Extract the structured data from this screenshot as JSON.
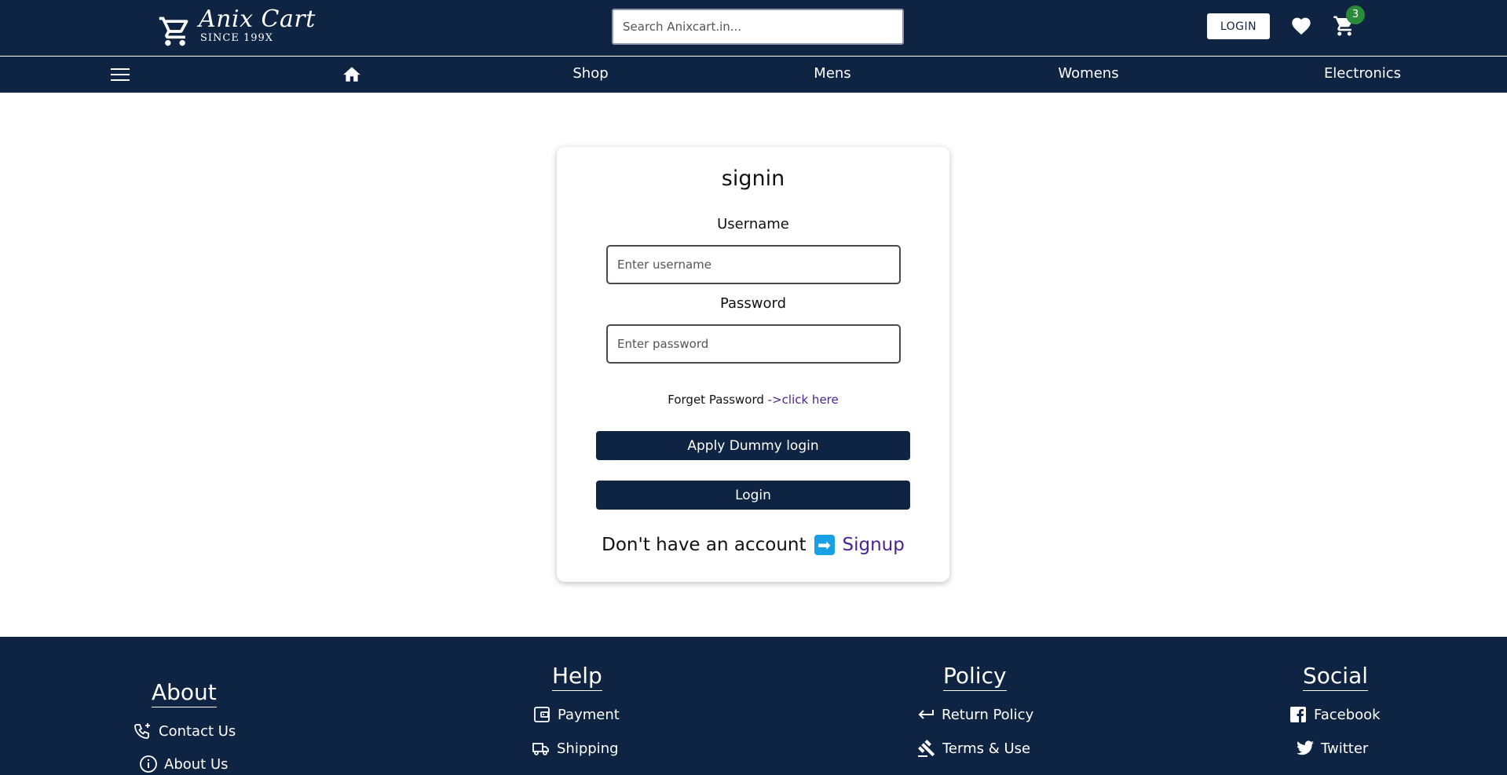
{
  "header": {
    "brand_name": "Anix Cart",
    "brand_sub": "SINCE 199X",
    "search_placeholder": "Search Anixcart.in...",
    "login_label": "LOGIN",
    "cart_count": "3"
  },
  "nav": {
    "items": [
      "Shop",
      "Mens",
      "Womens",
      "Electronics"
    ]
  },
  "signin": {
    "title": "signin",
    "username_label": "Username",
    "username_placeholder": "Enter username",
    "password_label": "Password",
    "password_placeholder": "Enter password",
    "forget_text": "Forget Password",
    "forget_link": "->click here",
    "dummy_button": "Apply Dummy login",
    "login_button": "Login",
    "no_account_text": "Don't have an account",
    "signup_arrow": "➡",
    "signup_link": "Signup"
  },
  "footer": {
    "about": {
      "title": "About",
      "links": [
        "Contact Us",
        "About Us"
      ]
    },
    "help": {
      "title": "Help",
      "links": [
        "Payment",
        "Shipping"
      ]
    },
    "policy": {
      "title": "Policy",
      "links": [
        "Return Policy",
        "Terms & Use"
      ]
    },
    "social": {
      "title": "Social",
      "links": [
        "Facebook",
        "Twitter"
      ]
    }
  },
  "colors": {
    "navy": "#0f2342",
    "badge_green": "#2a8a3a",
    "link_purple": "#4a2390",
    "signup_arrow_blue": "#1aa0e6"
  },
  "icons": {
    "header": [
      "cart-logo-icon",
      "heart-icon",
      "cart-icon"
    ],
    "nav": [
      "hamburger-icon",
      "home-icon"
    ],
    "footer": [
      "phone-icon",
      "info-icon",
      "wallet-icon",
      "truck-icon",
      "return-arrow-icon",
      "gavel-icon",
      "facebook-icon",
      "twitter-icon"
    ]
  }
}
